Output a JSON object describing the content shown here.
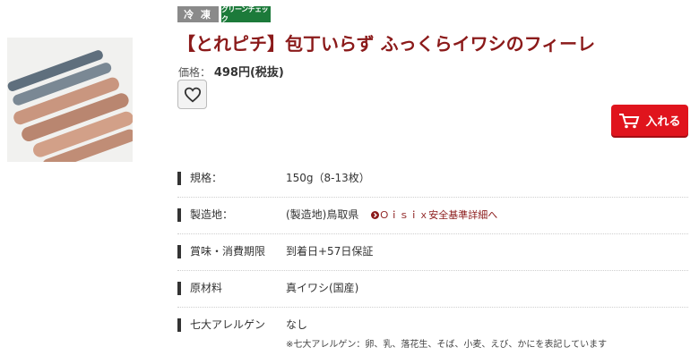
{
  "badges": {
    "frozen": "冷 凍",
    "green_check": "グリーンチェック"
  },
  "product": {
    "title": "【とれピチ】包丁いらず ふっくらイワシのフィーレ"
  },
  "price": {
    "label": "価格：",
    "value": "498円(税抜)"
  },
  "cart": {
    "label": "入れる"
  },
  "specs": {
    "size": {
      "label": "規格：",
      "value": "150g（8-13枚）"
    },
    "origin": {
      "label": "製造地：",
      "value": "(製造地)鳥取県",
      "link": "Ｏｉｓｉｘ安全基準詳細へ"
    },
    "expiry": {
      "label": "賞味・消費期限",
      "value": "到着日+57日保証"
    },
    "ingredients": {
      "label": "原材料",
      "value": "真イワシ(国産)"
    },
    "allergens": {
      "label": "七大アレルゲン",
      "value": "なし",
      "note": "※七大アレルゲン：卵、乳、落花生、そば、小麦、えび、かにを表記しています"
    }
  },
  "icons": {
    "favorite": "heart-icon",
    "cart": "cart-icon",
    "link_arrow": "circle-arrow-icon"
  },
  "colors": {
    "title": "#8b1a1a",
    "cart_button": "#e0141d",
    "green_badge": "#1c7a3a",
    "frozen_badge": "#8a8a8a"
  }
}
